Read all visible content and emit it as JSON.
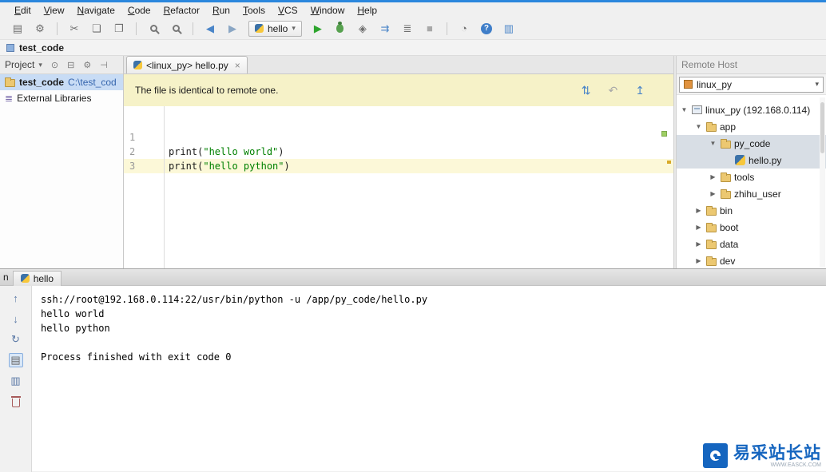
{
  "colors": {
    "accent_blue": "#2b87dd",
    "banner_bg": "#f6f2c8",
    "caret_line_bg": "#fcf8d8",
    "selection_blue": "#c8dcf5",
    "selection_gray": "#d8dee5",
    "run_green": "#2ea52e",
    "string_green": "#008000",
    "watermark_blue": "#1565bf"
  },
  "menubar": {
    "items": [
      "Edit",
      "View",
      "Navigate",
      "Code",
      "Refactor",
      "Run",
      "Tools",
      "VCS",
      "Window",
      "Help"
    ]
  },
  "toolbar": {
    "run_config": "hello"
  },
  "icons": {
    "save_all": "▤",
    "settings": "⚙",
    "cut": "✂",
    "copy": "❏",
    "paste": "❐",
    "back": "◀",
    "forward": "▶",
    "run": "▶",
    "coverage": "◈",
    "concurrency": "⇉",
    "restore_layout": "≣",
    "stop": "■",
    "profiler": "◔",
    "help": "?",
    "terminal": "▥",
    "combo_arrow": "▾",
    "dropdown_arrow": "▾",
    "chevron_down": "▼",
    "chevron_right": "▶",
    "close": "×",
    "compare": "⇅",
    "revert": "↶",
    "upload": "↥",
    "target": "⊙",
    "collapse_all": "⊟",
    "gear": "⚙",
    "hide": "⊣",
    "external_libs": "≣",
    "up": "↑",
    "down": "↓",
    "rerun": "↻",
    "pin": "▤",
    "console": "▥"
  },
  "navbar": {
    "crumb": "test_code"
  },
  "project_panel": {
    "title": "Project",
    "root_name": "test_code",
    "root_path": "C:\\test_cod",
    "external_libraries": "External Libraries"
  },
  "editor": {
    "tab_title": "<linux_py> hello.py",
    "banner_text": "The file is identical to remote one.",
    "lines": [
      {
        "num": "1",
        "pre": "",
        "str": "",
        "post": ""
      },
      {
        "num": "2",
        "pre": "print(",
        "str": "\"hello world\"",
        "post": ")"
      },
      {
        "num": "3",
        "pre": "print(",
        "str": "\"hello python\"",
        "post": ")"
      }
    ]
  },
  "remote_host": {
    "title": "Remote Host",
    "server": "linux_py",
    "tree": [
      {
        "label": "linux_py (192.168.0.114)"
      },
      {
        "label": "app"
      },
      {
        "label": "py_code"
      },
      {
        "label": "hello.py"
      },
      {
        "label": "tools"
      },
      {
        "label": "zhihu_user"
      },
      {
        "label": "bin"
      },
      {
        "label": "boot"
      },
      {
        "label": "data"
      },
      {
        "label": "dev"
      }
    ]
  },
  "run_panel": {
    "window_label_partial": "n",
    "tab_label": "hello",
    "console": [
      "ssh://root@192.168.0.114:22/usr/bin/python -u /app/py_code/hello.py",
      "hello world",
      "hello python",
      "",
      "Process finished with exit code 0"
    ]
  },
  "watermark": {
    "text": "易采站长站",
    "subtext": "WWW.EASCK.COM"
  }
}
